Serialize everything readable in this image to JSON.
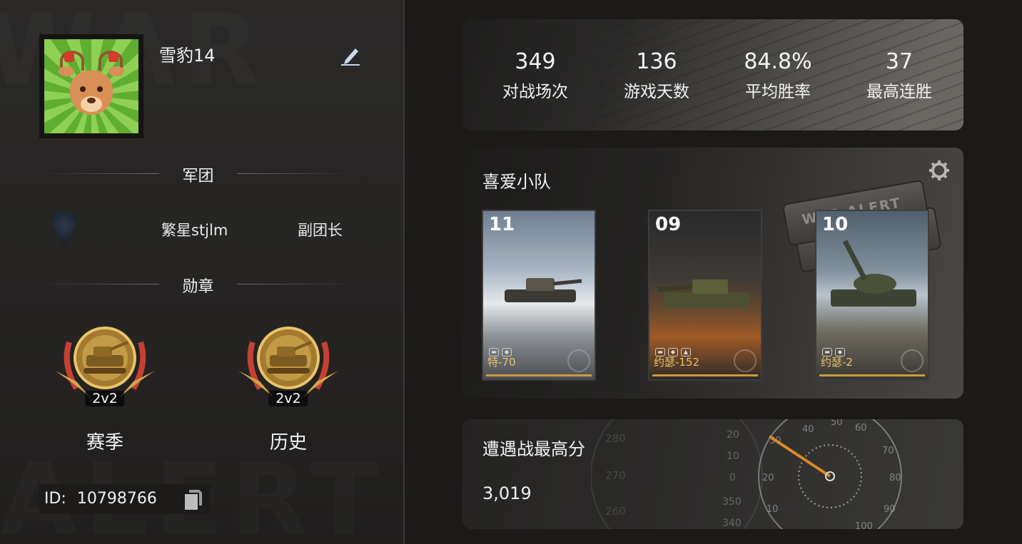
{
  "profile": {
    "username": "雪豹14",
    "id_label": "ID:",
    "id_value": "10798766"
  },
  "legion": {
    "section_title": "军团",
    "name": "繁星stjlm",
    "role": "副团长"
  },
  "medals": {
    "section_title": "勋章",
    "items": [
      {
        "tag": "2v2",
        "label": "赛季"
      },
      {
        "tag": "2v2",
        "label": "历史"
      }
    ]
  },
  "stats": [
    {
      "value": "349",
      "label": "对战场次"
    },
    {
      "value": "136",
      "label": "游戏天数"
    },
    {
      "value": "84.8%",
      "label": "平均胜率"
    },
    {
      "value": "37",
      "label": "最高连胜"
    }
  ],
  "squad": {
    "title": "喜爱小队",
    "dogtag_text": "WAR ALERT",
    "tanks": [
      {
        "level": "11",
        "name": "特-70"
      },
      {
        "level": "09",
        "name": "约瑟-152"
      },
      {
        "level": "10",
        "name": "约瑟-2"
      }
    ]
  },
  "encounter": {
    "title": "遭遇战最高分",
    "score": "3,019",
    "compass_left_scale": [
      "280",
      "270",
      "260"
    ],
    "compass_inner_scale": [
      "20",
      "10",
      "0",
      "350",
      "340"
    ],
    "gauge_labels": [
      "30",
      "40",
      "50",
      "60",
      "70",
      "80",
      "90",
      "100",
      "20",
      "10"
    ]
  },
  "colors": {
    "accent_gold": "#e9c26a",
    "gauge_needle": "#d98a2a"
  }
}
